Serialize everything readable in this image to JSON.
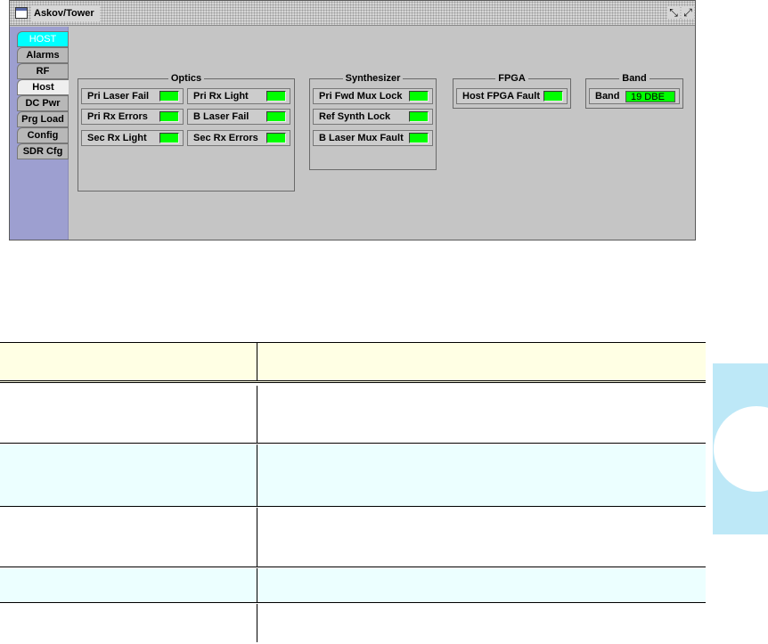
{
  "window": {
    "title": "Askov/Tower",
    "min_icon": "minimize-icon",
    "max_icon": "maximize-icon"
  },
  "tabs": [
    {
      "label": "HOST",
      "state": "selected"
    },
    {
      "label": "Alarms",
      "state": "normal"
    },
    {
      "label": "RF",
      "state": "normal"
    },
    {
      "label": "Host",
      "state": "active"
    },
    {
      "label": "DC Pwr",
      "state": "normal"
    },
    {
      "label": "Prg Load",
      "state": "normal"
    },
    {
      "label": "Config",
      "state": "normal"
    },
    {
      "label": "SDR Cfg",
      "state": "normal"
    }
  ],
  "groups": {
    "optics": {
      "title": "Optics",
      "indicators": [
        "Pri Laser Fail",
        "Pri Rx Light",
        "Pri Rx Errors",
        "B Laser Fail",
        "Sec Rx Light",
        "Sec Rx Errors"
      ]
    },
    "synthesizer": {
      "title": "Synthesizer",
      "indicators": [
        "Pri Fwd Mux Lock",
        "Ref Synth Lock",
        "B Laser Mux Fault"
      ]
    },
    "fpga": {
      "title": "FPGA",
      "indicators": [
        "Host FPGA Fault"
      ]
    },
    "band": {
      "title": "Band",
      "label": "Band",
      "value": "19  DBE"
    }
  },
  "colors": {
    "led_ok": "#00ff00",
    "selected_tab": "#00ffff",
    "table_header": "#ffffe4",
    "table_alt_row": "#ecffff",
    "side_tab": "#bde8f7"
  }
}
